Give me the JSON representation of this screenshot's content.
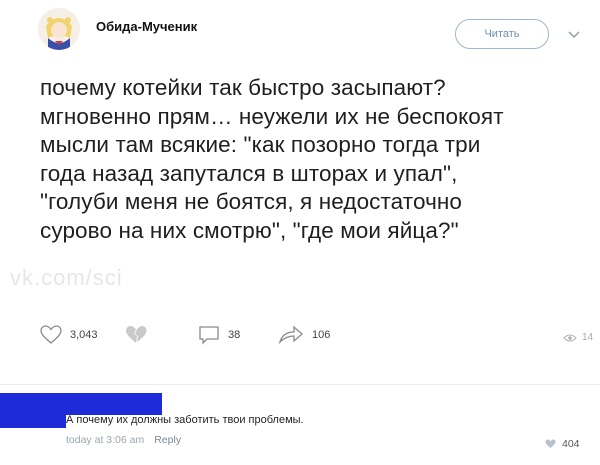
{
  "post": {
    "author": "Обида-Мученик",
    "follow_label": "Читать",
    "text_lines": [
      "почему котейки так быстро засыпают?",
      "мгновенно прям… неужели их не беспокоят",
      "мысли там всякие: \"как позорно тогда три",
      "года назад запутался в шторах и упал\",",
      "\"голуби меня не боятся, я недостаточно",
      "сурово на них смотрю\", \"где мои яйца?\""
    ],
    "watermark": "vk.com/sci",
    "actions": {
      "likes": "3,043",
      "replies": "38",
      "retweets": "106",
      "views": "14"
    }
  },
  "comment": {
    "text": "А почему их должны заботить твои проблемы.",
    "time": "today at 3:06 am",
    "reply_label": "Reply",
    "likes": "404"
  },
  "colors": {
    "redaction": "#1e2bd8",
    "follow_border": "#9fb6cc",
    "follow_text": "#6b8fb3"
  }
}
